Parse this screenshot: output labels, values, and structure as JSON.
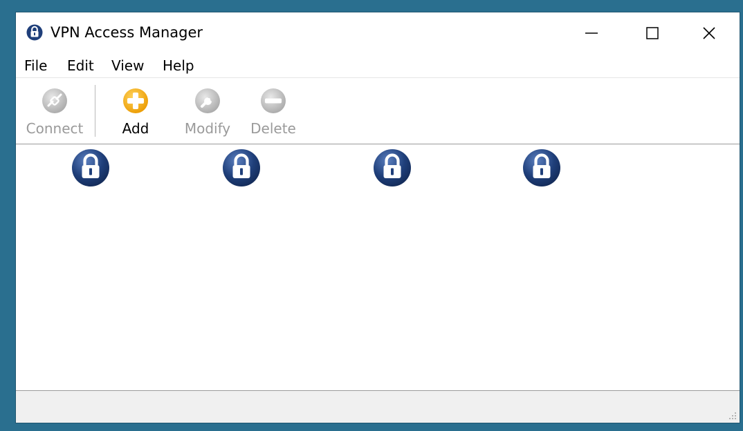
{
  "window": {
    "title": "VPN Access Manager"
  },
  "menu": [
    "File",
    "Edit",
    "View",
    "Help"
  ],
  "toolbar": {
    "connect_label": "Connect",
    "add_label": "Add",
    "modify_label": "Modify",
    "delete_label": "Delete"
  },
  "connections": [
    {
      "label": ""
    },
    {
      "label": ""
    },
    {
      "label": ""
    },
    {
      "label": ""
    }
  ],
  "colors": {
    "desktop": "#2a6f8f",
    "lock_blue": "#1f3f7a",
    "add_orange": "#f2a70e",
    "disabled_gray": "#9a9a9a"
  },
  "icons": {
    "title": "lock-icon",
    "connect": "connect-icon",
    "add": "add-icon",
    "modify": "wrench-icon",
    "delete": "minus-icon",
    "connection": "lock-icon"
  }
}
